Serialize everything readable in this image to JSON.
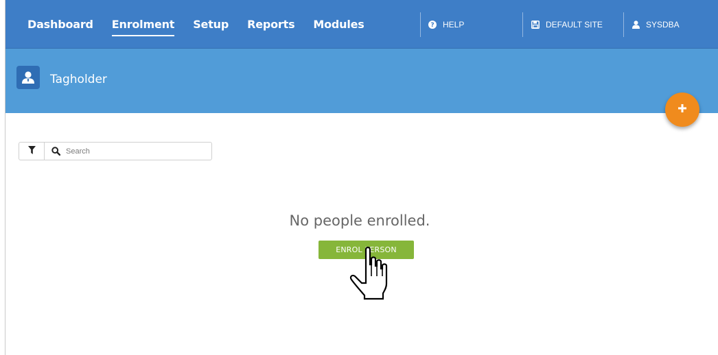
{
  "nav": {
    "items": [
      {
        "label": "Dashboard",
        "active": false
      },
      {
        "label": "Enrolment",
        "active": true
      },
      {
        "label": "Setup",
        "active": false
      },
      {
        "label": "Reports",
        "active": false
      },
      {
        "label": "Modules",
        "active": false
      }
    ],
    "help_label": "HELP",
    "site_label": "DEFAULT SITE",
    "user_label": "SYSDBA"
  },
  "header": {
    "title": "Tagholder",
    "icon": "user-icon"
  },
  "search": {
    "placeholder": "Search",
    "value": ""
  },
  "empty_state": {
    "message": "No people enrolled.",
    "button_label": "ENROL PERSON"
  },
  "colors": {
    "nav_bg": "#3e7ec7",
    "header_bg": "#519cd8",
    "fab": "#f08b1d",
    "primary_button": "#86b63a"
  },
  "icons": {
    "help": "question-circle-icon",
    "site": "floppy-disk-icon",
    "user": "user-icon",
    "filter": "funnel-icon",
    "search": "magnifier-icon",
    "fab": "plus-icon",
    "cursor": "hand-pointer-icon"
  }
}
